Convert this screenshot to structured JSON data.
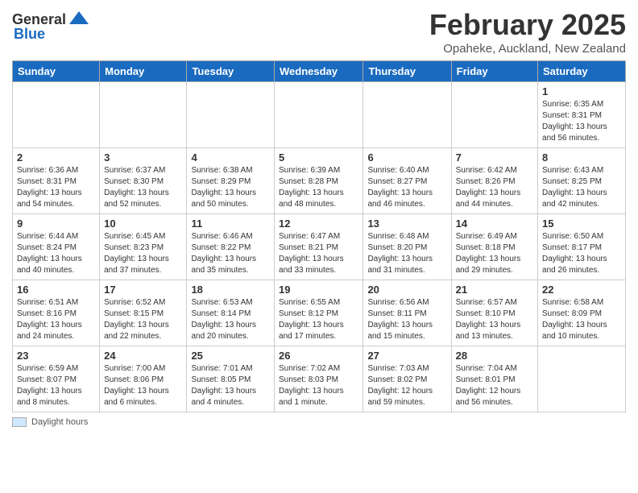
{
  "header": {
    "logo_general": "General",
    "logo_blue": "Blue",
    "month_year": "February 2025",
    "location": "Opaheke, Auckland, New Zealand"
  },
  "weekdays": [
    "Sunday",
    "Monday",
    "Tuesday",
    "Wednesday",
    "Thursday",
    "Friday",
    "Saturday"
  ],
  "weeks": [
    [
      {
        "day": "",
        "info": ""
      },
      {
        "day": "",
        "info": ""
      },
      {
        "day": "",
        "info": ""
      },
      {
        "day": "",
        "info": ""
      },
      {
        "day": "",
        "info": ""
      },
      {
        "day": "",
        "info": ""
      },
      {
        "day": "1",
        "info": "Sunrise: 6:35 AM\nSunset: 8:31 PM\nDaylight: 13 hours and 56 minutes."
      }
    ],
    [
      {
        "day": "2",
        "info": "Sunrise: 6:36 AM\nSunset: 8:31 PM\nDaylight: 13 hours and 54 minutes."
      },
      {
        "day": "3",
        "info": "Sunrise: 6:37 AM\nSunset: 8:30 PM\nDaylight: 13 hours and 52 minutes."
      },
      {
        "day": "4",
        "info": "Sunrise: 6:38 AM\nSunset: 8:29 PM\nDaylight: 13 hours and 50 minutes."
      },
      {
        "day": "5",
        "info": "Sunrise: 6:39 AM\nSunset: 8:28 PM\nDaylight: 13 hours and 48 minutes."
      },
      {
        "day": "6",
        "info": "Sunrise: 6:40 AM\nSunset: 8:27 PM\nDaylight: 13 hours and 46 minutes."
      },
      {
        "day": "7",
        "info": "Sunrise: 6:42 AM\nSunset: 8:26 PM\nDaylight: 13 hours and 44 minutes."
      },
      {
        "day": "8",
        "info": "Sunrise: 6:43 AM\nSunset: 8:25 PM\nDaylight: 13 hours and 42 minutes."
      }
    ],
    [
      {
        "day": "9",
        "info": "Sunrise: 6:44 AM\nSunset: 8:24 PM\nDaylight: 13 hours and 40 minutes."
      },
      {
        "day": "10",
        "info": "Sunrise: 6:45 AM\nSunset: 8:23 PM\nDaylight: 13 hours and 37 minutes."
      },
      {
        "day": "11",
        "info": "Sunrise: 6:46 AM\nSunset: 8:22 PM\nDaylight: 13 hours and 35 minutes."
      },
      {
        "day": "12",
        "info": "Sunrise: 6:47 AM\nSunset: 8:21 PM\nDaylight: 13 hours and 33 minutes."
      },
      {
        "day": "13",
        "info": "Sunrise: 6:48 AM\nSunset: 8:20 PM\nDaylight: 13 hours and 31 minutes."
      },
      {
        "day": "14",
        "info": "Sunrise: 6:49 AM\nSunset: 8:18 PM\nDaylight: 13 hours and 29 minutes."
      },
      {
        "day": "15",
        "info": "Sunrise: 6:50 AM\nSunset: 8:17 PM\nDaylight: 13 hours and 26 minutes."
      }
    ],
    [
      {
        "day": "16",
        "info": "Sunrise: 6:51 AM\nSunset: 8:16 PM\nDaylight: 13 hours and 24 minutes."
      },
      {
        "day": "17",
        "info": "Sunrise: 6:52 AM\nSunset: 8:15 PM\nDaylight: 13 hours and 22 minutes."
      },
      {
        "day": "18",
        "info": "Sunrise: 6:53 AM\nSunset: 8:14 PM\nDaylight: 13 hours and 20 minutes."
      },
      {
        "day": "19",
        "info": "Sunrise: 6:55 AM\nSunset: 8:12 PM\nDaylight: 13 hours and 17 minutes."
      },
      {
        "day": "20",
        "info": "Sunrise: 6:56 AM\nSunset: 8:11 PM\nDaylight: 13 hours and 15 minutes."
      },
      {
        "day": "21",
        "info": "Sunrise: 6:57 AM\nSunset: 8:10 PM\nDaylight: 13 hours and 13 minutes."
      },
      {
        "day": "22",
        "info": "Sunrise: 6:58 AM\nSunset: 8:09 PM\nDaylight: 13 hours and 10 minutes."
      }
    ],
    [
      {
        "day": "23",
        "info": "Sunrise: 6:59 AM\nSunset: 8:07 PM\nDaylight: 13 hours and 8 minutes."
      },
      {
        "day": "24",
        "info": "Sunrise: 7:00 AM\nSunset: 8:06 PM\nDaylight: 13 hours and 6 minutes."
      },
      {
        "day": "25",
        "info": "Sunrise: 7:01 AM\nSunset: 8:05 PM\nDaylight: 13 hours and 4 minutes."
      },
      {
        "day": "26",
        "info": "Sunrise: 7:02 AM\nSunset: 8:03 PM\nDaylight: 13 hours and 1 minute."
      },
      {
        "day": "27",
        "info": "Sunrise: 7:03 AM\nSunset: 8:02 PM\nDaylight: 12 hours and 59 minutes."
      },
      {
        "day": "28",
        "info": "Sunrise: 7:04 AM\nSunset: 8:01 PM\nDaylight: 12 hours and 56 minutes."
      },
      {
        "day": "",
        "info": ""
      }
    ]
  ],
  "legend": {
    "box_label": "Daylight hours"
  }
}
